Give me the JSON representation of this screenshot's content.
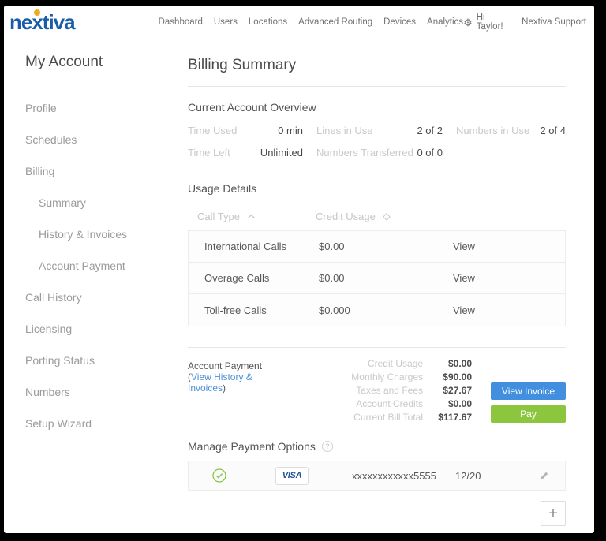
{
  "brand": {
    "logo": "nextiva"
  },
  "topnav": {
    "items": [
      "Dashboard",
      "Users",
      "Locations",
      "Advanced Routing",
      "Devices",
      "Analytics"
    ],
    "greeting": "Hi Taylor!",
    "support": "Nextiva Support"
  },
  "sidebar": {
    "title": "My Account",
    "items": [
      "Profile",
      "Schedules",
      "Billing",
      "Summary",
      "History & Invoices",
      "Account Payment",
      "Call History",
      "Licensing",
      "Porting Status",
      "Numbers",
      "Setup Wizard"
    ]
  },
  "main": {
    "title": "Billing Summary",
    "overview": {
      "heading": "Current Account Overview",
      "stats": [
        {
          "label": "Time Used",
          "value": "0 min"
        },
        {
          "label": "Lines in Use",
          "value": "2 of 2"
        },
        {
          "label": "Numbers in Use",
          "value": "2 of 4"
        },
        {
          "label": "Time Left",
          "value": "Unlimited"
        },
        {
          "label": "Numbers Transferred",
          "value": "0 of 0"
        }
      ]
    },
    "usage": {
      "heading": "Usage Details",
      "columns": [
        "Call Type",
        "Credit Usage"
      ],
      "rows": [
        {
          "type": "International Calls",
          "credit": "$0.00",
          "action": "View"
        },
        {
          "type": "Overage Calls",
          "credit": "$0.00",
          "action": "View"
        },
        {
          "type": "Toll-free Calls",
          "credit": "$0.000",
          "action": "View"
        }
      ]
    },
    "payment": {
      "label": "Account Payment",
      "open_paren": " (",
      "link": "View History & Invoices",
      "close_paren": ")",
      "lines": [
        {
          "label": "Credit Usage",
          "value": "$0.00"
        },
        {
          "label": "Monthly Charges",
          "value": "$90.00"
        },
        {
          "label": "Taxes and Fees",
          "value": "$27.67"
        },
        {
          "label": "Account Credits",
          "value": "$0.00"
        },
        {
          "label": "Current Bill Total",
          "value": "$117.67"
        }
      ],
      "view_invoice": "View Invoice",
      "pay": "Pay"
    },
    "manage": {
      "heading": "Manage Payment Options",
      "help": "?",
      "card": {
        "brand": "VISA",
        "number": "xxxxxxxxxxxx5555",
        "expiry": "12/20"
      },
      "add": "+"
    }
  },
  "colors": {
    "logo_blue": "#1A5CA8",
    "logo_dot": "#F5A623",
    "link_blue": "#4A90D9",
    "button_blue": "#418FDE",
    "button_green": "#8CC63F",
    "check_green": "#8BC34A",
    "visa_blue": "#24539B"
  }
}
